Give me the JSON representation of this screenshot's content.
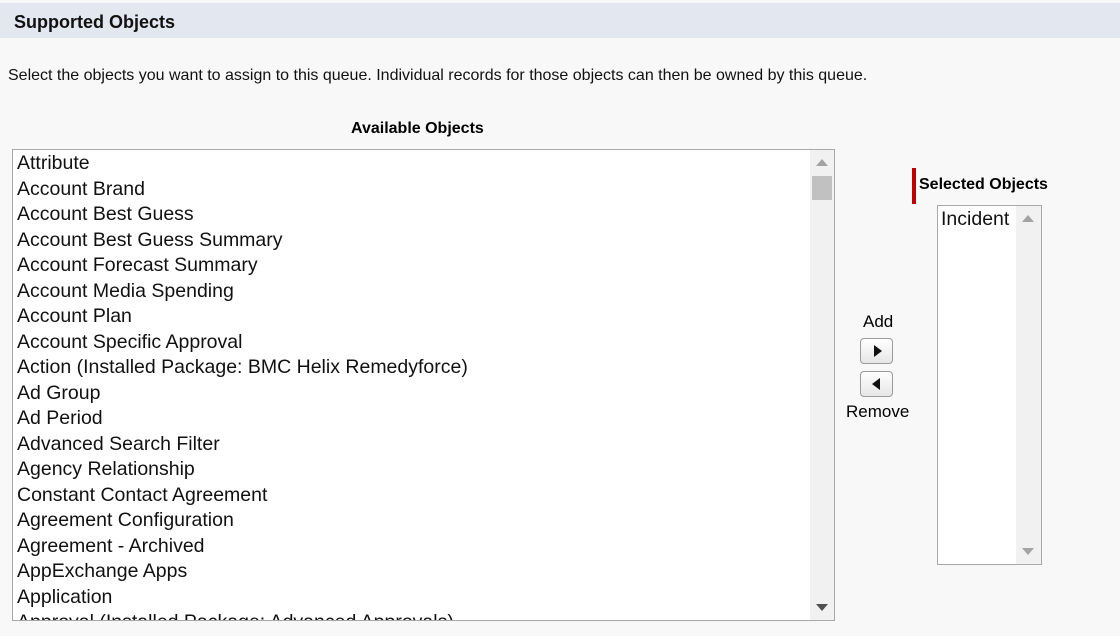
{
  "section": {
    "title": "Supported Objects"
  },
  "instructions": "Select the objects you want to assign to this queue. Individual records for those objects can then be owned by this queue.",
  "available": {
    "label": "Available Objects",
    "items": [
      "Attribute",
      "Account Brand",
      "Account Best Guess",
      "Account Best Guess Summary",
      "Account Forecast Summary",
      "Account Media Spending",
      "Account Plan",
      "Account Specific Approval",
      "Action (Installed Package: BMC Helix Remedyforce)",
      "Ad Group",
      "Ad Period",
      "Advanced Search Filter",
      "Agency Relationship",
      "Constant Contact Agreement",
      "Agreement Configuration",
      "Agreement - Archived",
      "AppExchange Apps",
      "Application",
      "Approval (Installed Package: Advanced Approvals)"
    ]
  },
  "actions": {
    "add_label": "Add",
    "remove_label": "Remove"
  },
  "selected": {
    "label": "Selected Objects",
    "items": [
      "Incident"
    ]
  },
  "icons": {
    "add": "triangle-right-icon",
    "remove": "triangle-left-icon",
    "scroll_up": "scroll-up-arrow-icon",
    "scroll_down": "scroll-down-arrow-icon"
  },
  "colors": {
    "header_bg": "#e3e7ef",
    "required": "#c00000",
    "page_bg": "#f8f8f8"
  }
}
